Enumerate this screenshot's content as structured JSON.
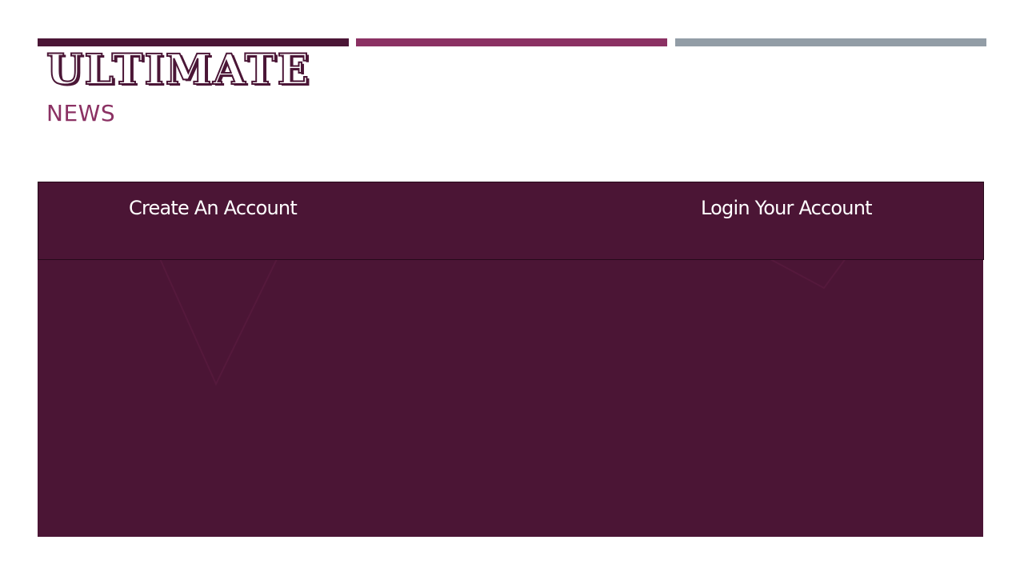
{
  "header": {
    "title": "ULTIMATE",
    "subtitle": "NEWS",
    "accent_colors": [
      "#4b1636",
      "#8b3163",
      "#929da6"
    ]
  },
  "menu": {
    "create_account": "Create An Account",
    "login_account": "Login Your Account"
  },
  "theme": {
    "panel_color": "#4b1535",
    "text_color": "#ffffff"
  }
}
